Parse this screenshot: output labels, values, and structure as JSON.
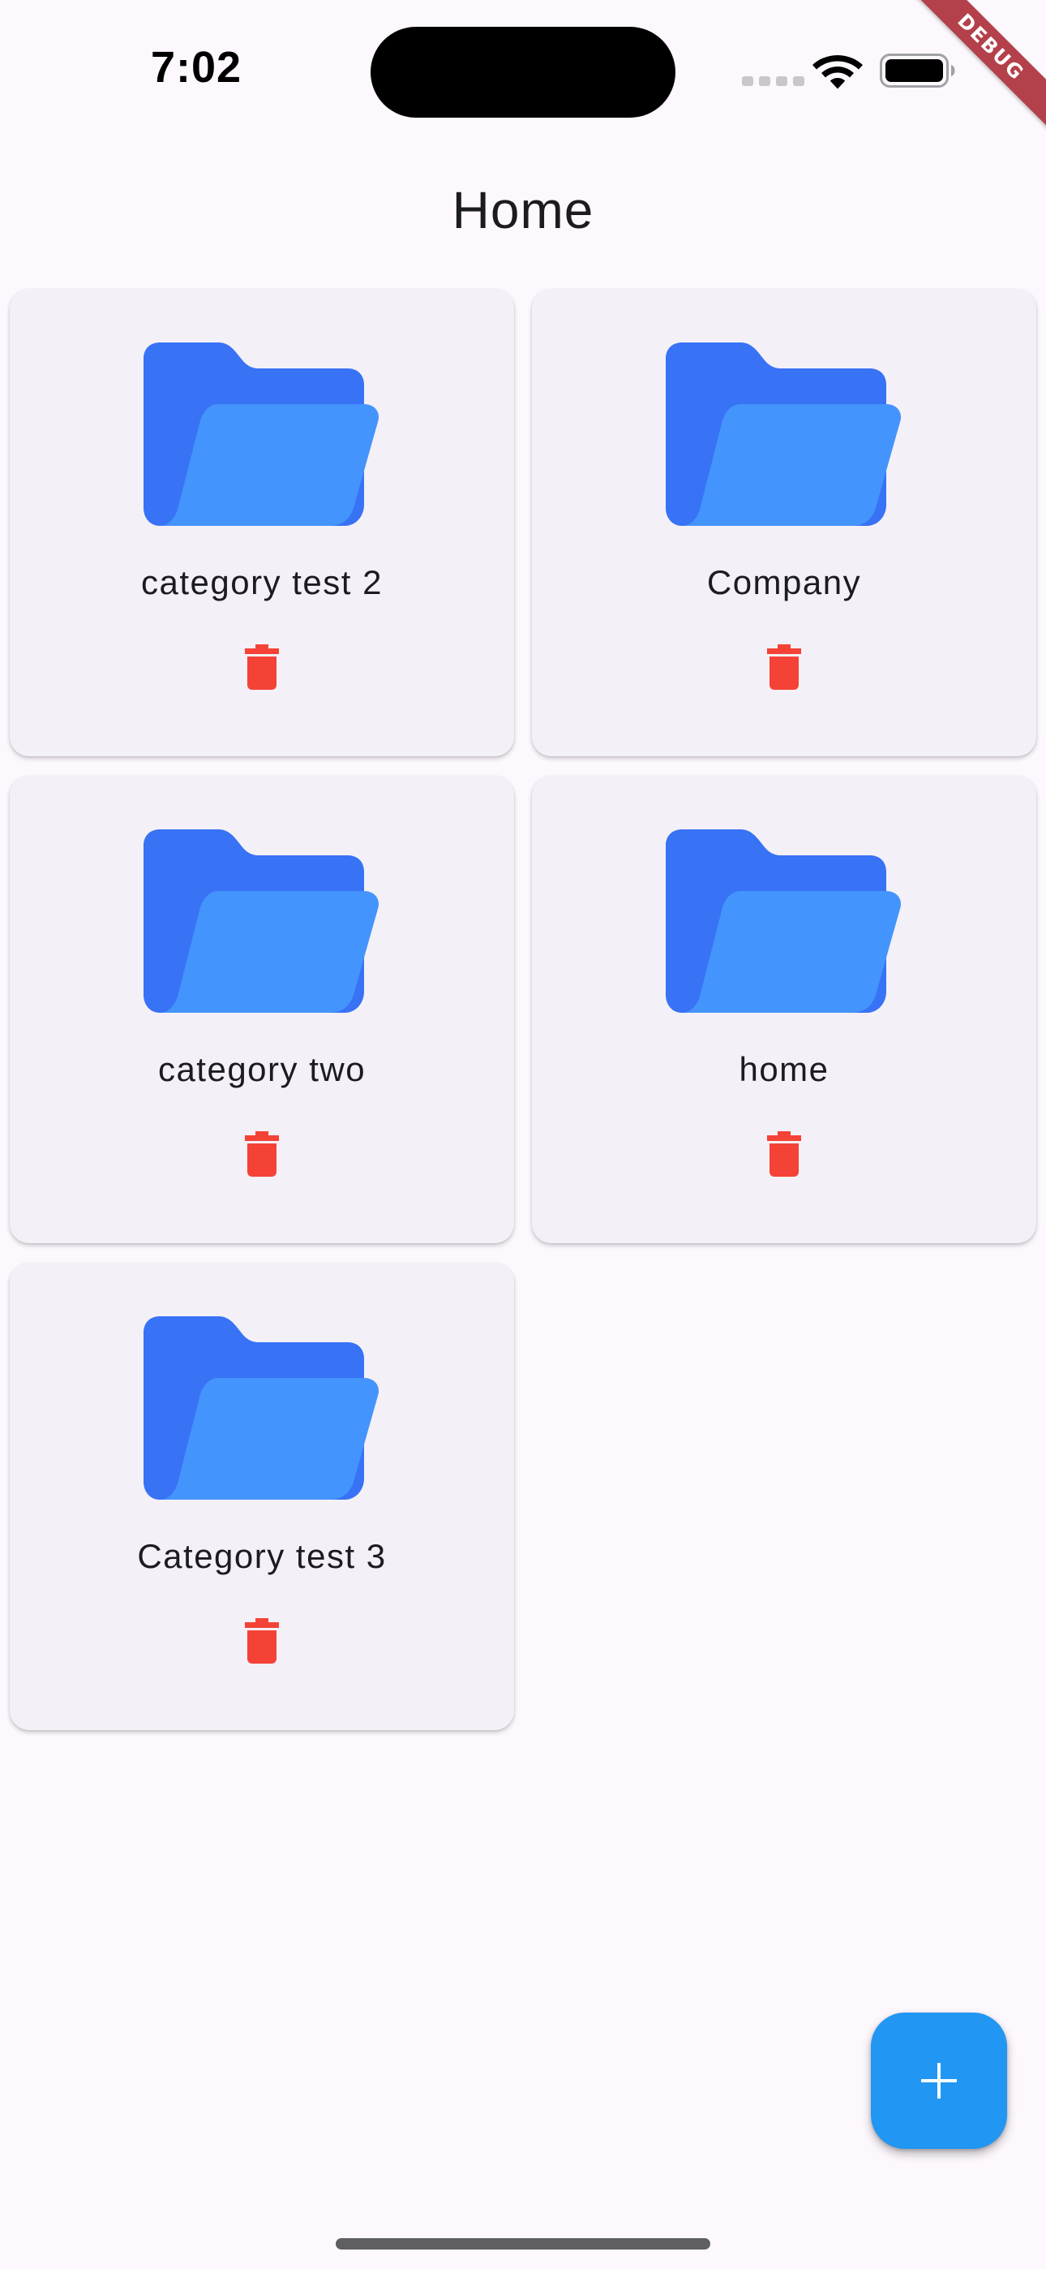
{
  "status_bar": {
    "time": "7:02"
  },
  "debug_banner": {
    "label": "DEBUG",
    "color": "#b3404a"
  },
  "app_bar": {
    "title": "Home"
  },
  "categories": [
    {
      "name": "category test 2",
      "icon": "folder-open-icon",
      "action_icon": "delete-icon"
    },
    {
      "name": "Company",
      "icon": "folder-open-icon",
      "action_icon": "delete-icon"
    },
    {
      "name": "category two",
      "icon": "folder-open-icon",
      "action_icon": "delete-icon"
    },
    {
      "name": "home",
      "icon": "folder-open-icon",
      "action_icon": "delete-icon"
    },
    {
      "name": "Category test 3",
      "icon": "folder-open-icon",
      "action_icon": "delete-icon"
    }
  ],
  "fab": {
    "icon": "plus-icon",
    "color": "#2196f3"
  },
  "colors": {
    "background": "#fdf8fd",
    "card": "#f4f0f7",
    "folder_back": "#3872f5",
    "folder_front": "#4494fd",
    "delete": "#f44336"
  }
}
